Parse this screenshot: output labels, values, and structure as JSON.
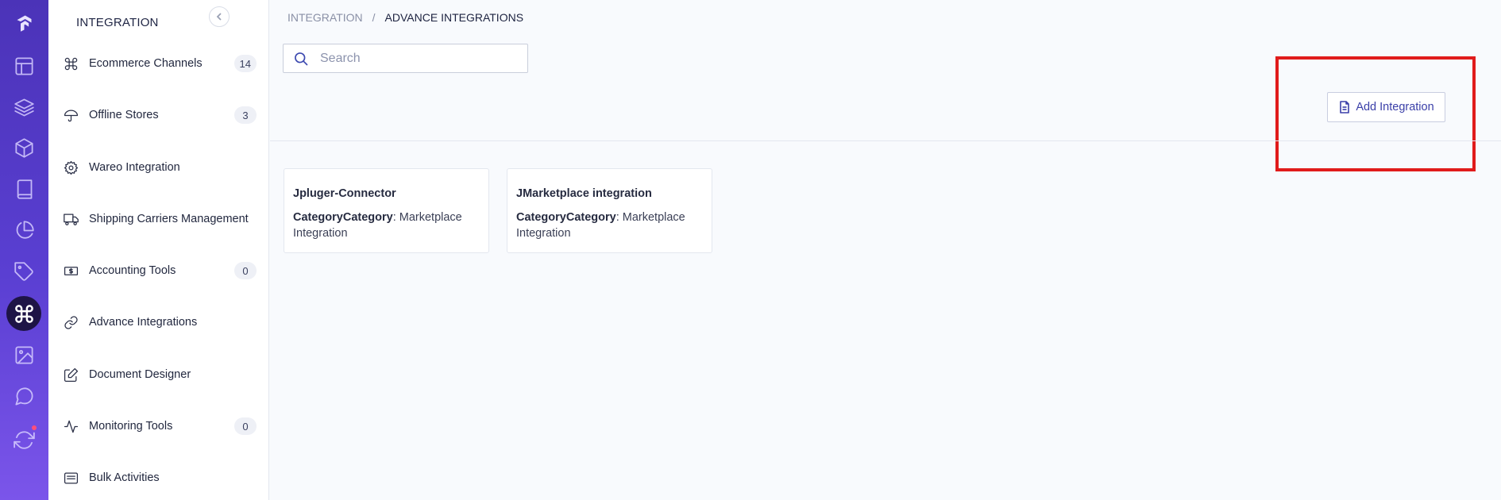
{
  "sidebar": {
    "title": "INTEGRATION",
    "items": [
      {
        "label": "Ecommerce Channels",
        "count": "14"
      },
      {
        "label": "Offline Stores",
        "count": "3"
      },
      {
        "label": "Wareo Integration",
        "count": ""
      },
      {
        "label": "Shipping Carriers Management",
        "count": ""
      },
      {
        "label": "Accounting Tools",
        "count": "0"
      },
      {
        "label": "Advance Integrations",
        "count": ""
      },
      {
        "label": "Document Designer",
        "count": ""
      },
      {
        "label": "Monitoring Tools",
        "count": "0"
      },
      {
        "label": "Bulk Activities",
        "count": ""
      }
    ]
  },
  "breadcrumb": {
    "parent": "INTEGRATION",
    "separator": "/",
    "current": "ADVANCE INTEGRATIONS"
  },
  "search": {
    "placeholder": "Search"
  },
  "toolbar": {
    "add_label": "Add Integration"
  },
  "cards": [
    {
      "title": "Jpluger-Connector",
      "meta_key": "CategoryCategory",
      "meta_value": ": Marketplace Integration"
    },
    {
      "title": "JMarketplace integration",
      "meta_key": "CategoryCategory",
      "meta_value": ": Marketplace Integration"
    }
  ],
  "colors": {
    "rail_top": "#4b33b8",
    "rail_bottom": "#7b55ea",
    "active_rail": "#1e1446",
    "accent": "#3a3fa8",
    "highlight": "#e01b1b"
  },
  "icons": {
    "rail": [
      "logo-icon",
      "layout-icon",
      "layers-icon",
      "box-icon",
      "book-icon",
      "pie-chart-icon",
      "tag-icon",
      "command-icon",
      "image-icon",
      "chat-icon",
      "refresh-icon"
    ],
    "nav": [
      "command-icon",
      "umbrella-icon",
      "gear-icon",
      "truck-icon",
      "money-icon",
      "link-icon",
      "edit-icon",
      "activity-icon",
      "list-icon"
    ]
  }
}
